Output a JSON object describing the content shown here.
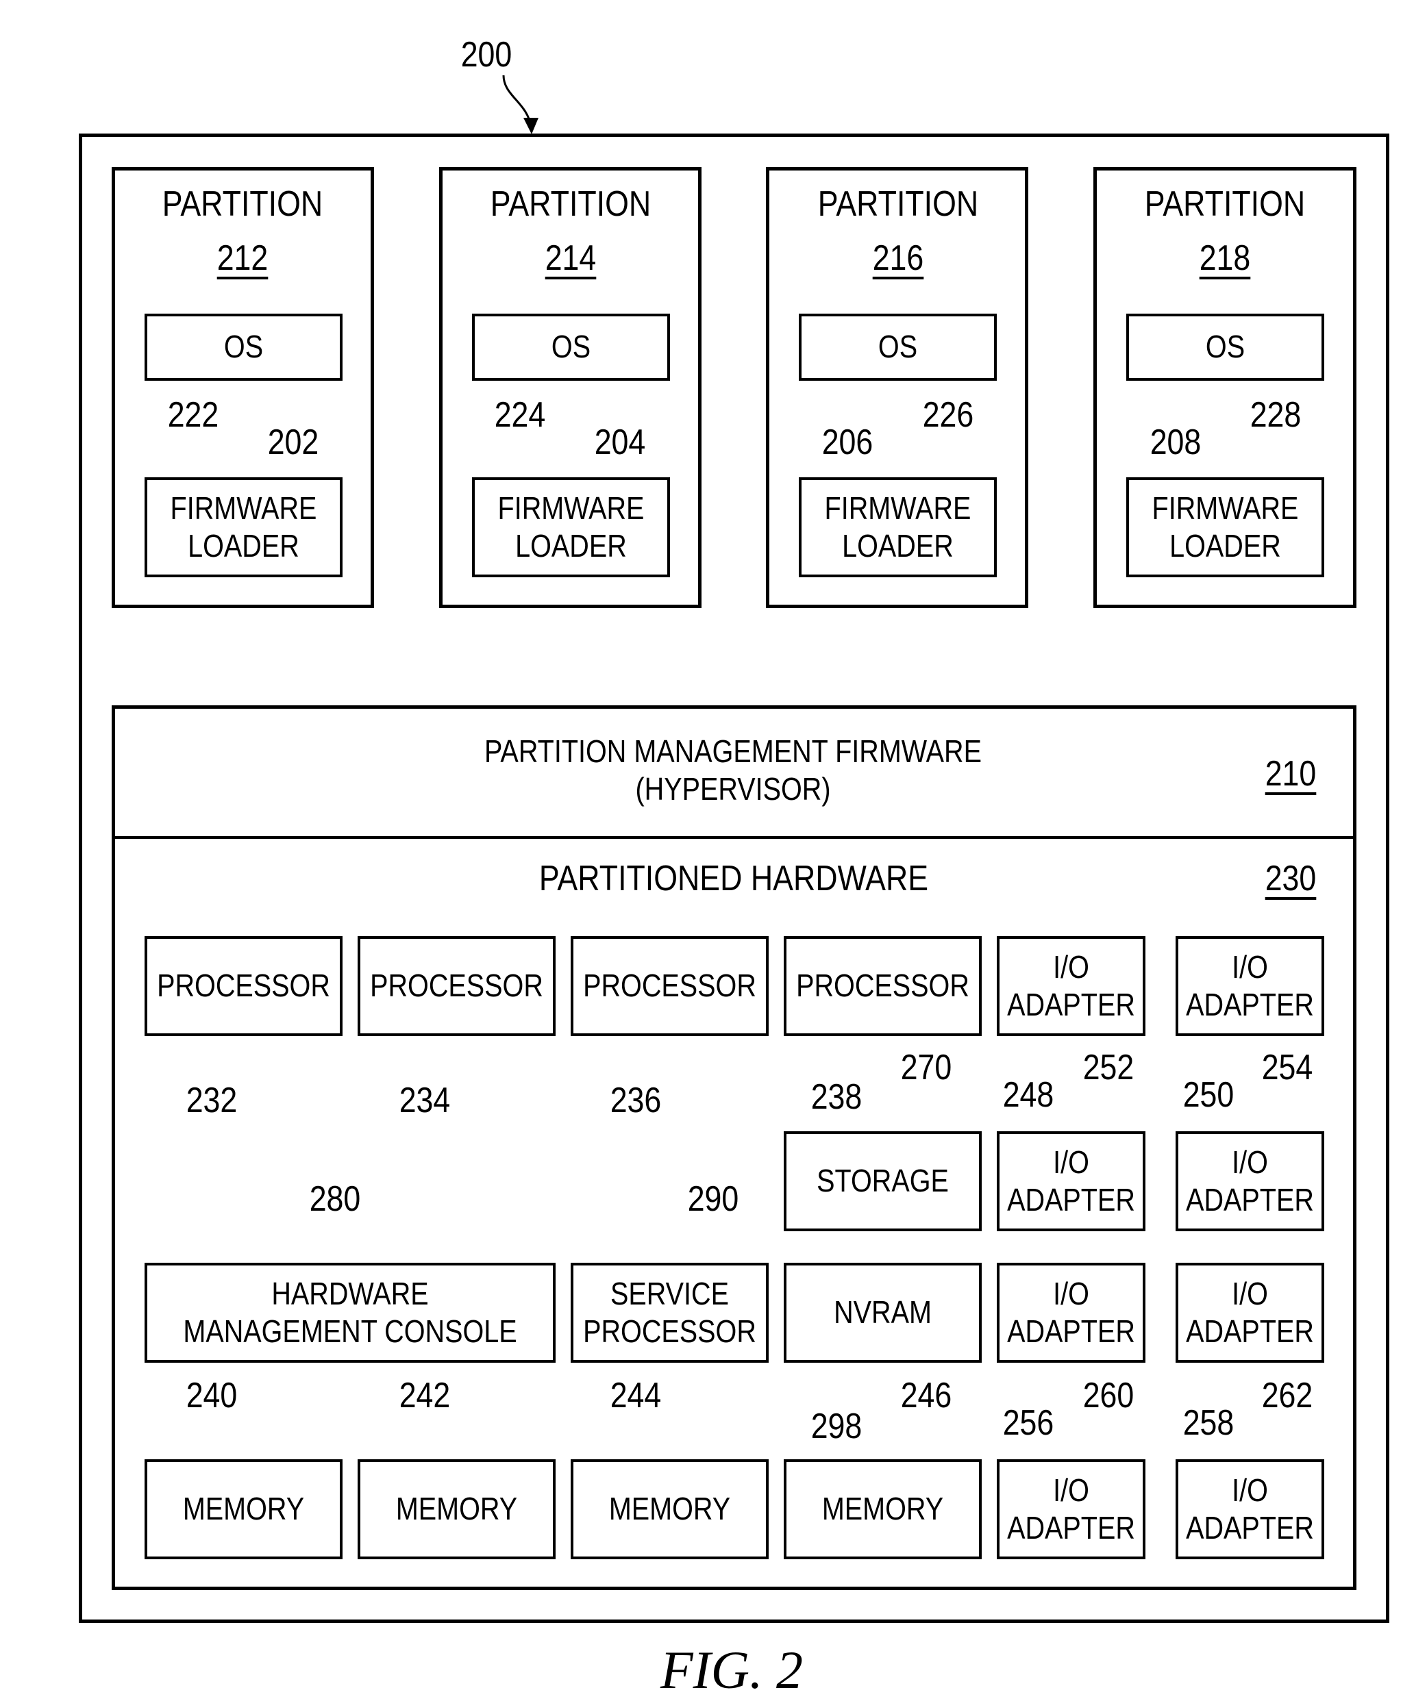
{
  "figure": {
    "ref": "200",
    "caption": "FIG. 2"
  },
  "partitions": [
    {
      "title": "PARTITION",
      "number": "212",
      "os_label": "OS",
      "os_ref": "202",
      "loader_label": "FIRMWARE\nLOADER",
      "loader_ref": "222"
    },
    {
      "title": "PARTITION",
      "number": "214",
      "os_label": "OS",
      "os_ref": "204",
      "loader_label": "FIRMWARE\nLOADER",
      "loader_ref": "224"
    },
    {
      "title": "PARTITION",
      "number": "216",
      "os_label": "OS",
      "os_ref": "206",
      "loader_label": "FIRMWARE\nLOADER",
      "loader_ref": "226"
    },
    {
      "title": "PARTITION",
      "number": "218",
      "os_label": "OS",
      "os_ref": "208",
      "loader_label": "FIRMWARE\nLOADER",
      "loader_ref": "228"
    }
  ],
  "hypervisor": {
    "title": "PARTITION MANAGEMENT FIRMWARE\n(HYPERVISOR)",
    "ref": "210"
  },
  "hardware": {
    "title": "PARTITIONED HARDWARE",
    "ref": "230",
    "processors": [
      {
        "label": "PROCESSOR",
        "ref": "232"
      },
      {
        "label": "PROCESSOR",
        "ref": "234"
      },
      {
        "label": "PROCESSOR",
        "ref": "236"
      },
      {
        "label": "PROCESSOR",
        "ref": "238"
      }
    ],
    "storage": {
      "label": "STORAGE",
      "ref": "270"
    },
    "nvram": {
      "label": "NVRAM",
      "ref": "298"
    },
    "hmc": {
      "label": "HARDWARE\nMANAGEMENT CONSOLE",
      "ref": "280"
    },
    "service_processor": {
      "label": "SERVICE\nPROCESSOR",
      "ref": "290"
    },
    "memories": [
      {
        "label": "MEMORY",
        "ref": "240"
      },
      {
        "label": "MEMORY",
        "ref": "242"
      },
      {
        "label": "MEMORY",
        "ref": "244"
      },
      {
        "label": "MEMORY",
        "ref": "246"
      }
    ],
    "io_adapters": [
      {
        "label": "I/O\nADAPTER",
        "ref": "248"
      },
      {
        "label": "I/O\nADAPTER",
        "ref": "250"
      },
      {
        "label": "I/O\nADAPTER",
        "ref": "252"
      },
      {
        "label": "I/O\nADAPTER",
        "ref": "254"
      },
      {
        "label": "I/O\nADAPTER",
        "ref": "256"
      },
      {
        "label": "I/O\nADAPTER",
        "ref": "258"
      },
      {
        "label": "I/O\nADAPTER",
        "ref": "260"
      },
      {
        "label": "I/O\nADAPTER",
        "ref": "262"
      }
    ]
  }
}
